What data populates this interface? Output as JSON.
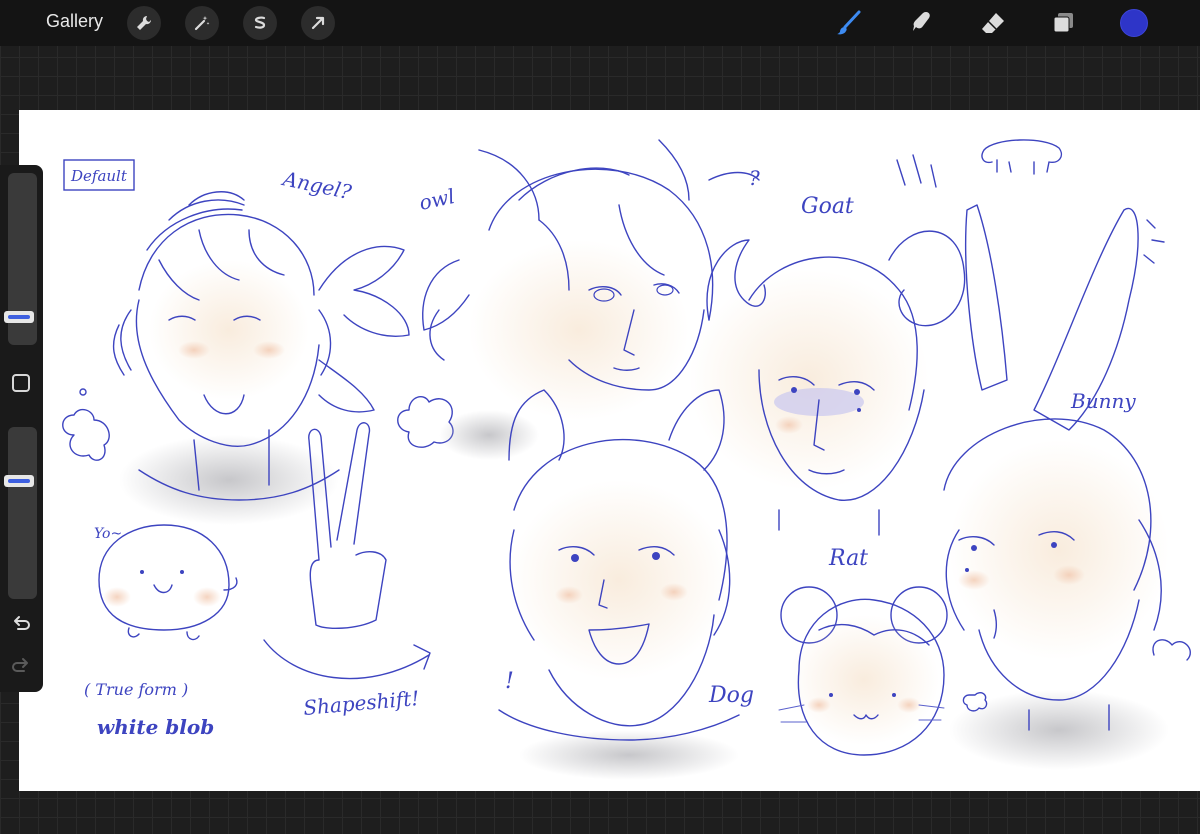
{
  "topbar": {
    "gallery_label": "Gallery",
    "left_tools": [
      "wrench-icon",
      "magic-wand-icon",
      "selection-icon",
      "transform-arrow-icon"
    ],
    "right_tools": [
      "brush-icon",
      "smudge-icon",
      "eraser-icon",
      "layers-icon"
    ],
    "active_tool": "brush-icon",
    "current_color": "#2e35c8"
  },
  "sidebar": {
    "brush_size_level": 0.55,
    "opacity_level": 0.66,
    "buttons": [
      "modify-square-icon",
      "undo-icon",
      "redo-icon"
    ]
  },
  "canvas": {
    "ink_color": "#3d44c0",
    "labels": {
      "default": "Default",
      "angel": "Angel?",
      "owl": "owl",
      "owl_q": "?",
      "goat": "Goat",
      "bunny": "Bunny",
      "rat": "Rat",
      "dog": "Dog",
      "yo": "Yo~",
      "true_form": "( True form )",
      "white_blob": "white blob",
      "shapeshift": "Shapeshift!",
      "dog_exclaim": "!"
    }
  }
}
